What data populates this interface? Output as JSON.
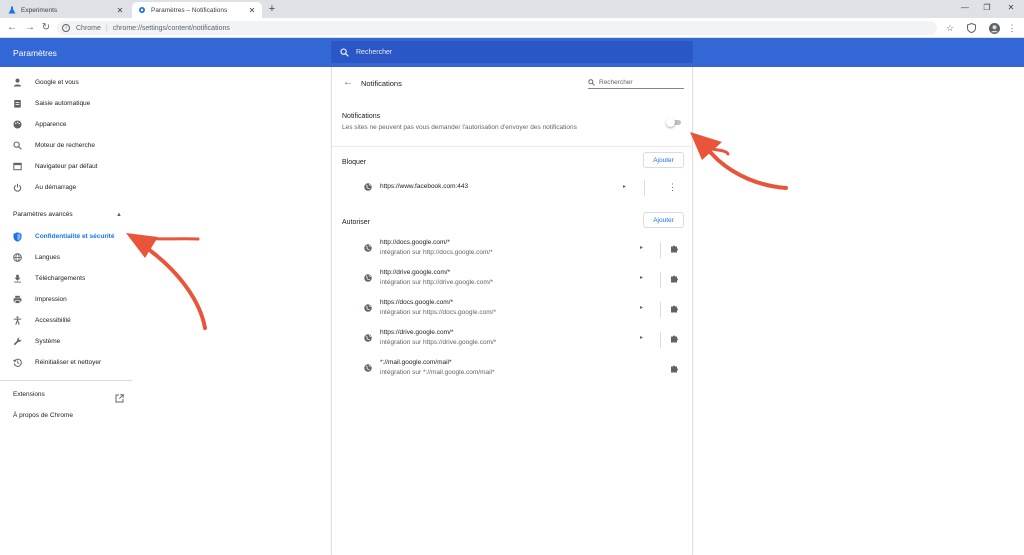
{
  "browser": {
    "tabs": [
      {
        "title": "Experiments",
        "icon": "flask-icon",
        "active": false
      },
      {
        "title": "Paramètres – Notifications",
        "icon": "gear-icon",
        "active": true
      }
    ],
    "close_glyph": "✕",
    "new_tab_glyph": "+",
    "window_controls": {
      "minimize": "—",
      "maximize": "❐",
      "close": "✕"
    },
    "nav": {
      "back": "←",
      "forward": "→",
      "reload": "↻"
    },
    "omnibox": {
      "scheme": "Chrome",
      "separator": "|",
      "url": "chrome://settings/content/notifications"
    },
    "toolbar_icons": {
      "star": "☆",
      "shield": "shield-icon",
      "avatar": "avatar-icon",
      "menu": "⋮"
    }
  },
  "header": {
    "title": "Paramètres",
    "search_placeholder": "Rechercher",
    "color": "#3367d6"
  },
  "sidebar": {
    "items": [
      {
        "label": "Google et vous",
        "icon": "person-icon"
      },
      {
        "label": "Saisie automatique",
        "icon": "clipboard-icon"
      },
      {
        "label": "Apparence",
        "icon": "palette-icon"
      },
      {
        "label": "Moteur de recherche",
        "icon": "search-icon"
      },
      {
        "label": "Navigateur par défaut",
        "icon": "browser-icon"
      },
      {
        "label": "Au démarrage",
        "icon": "power-icon"
      }
    ],
    "advanced_label": "Paramètres avancés",
    "advanced_caret": "▲",
    "advanced_items": [
      {
        "label": "Confidentialité et sécurité",
        "icon": "shield-icon",
        "active": true
      },
      {
        "label": "Langues",
        "icon": "globe-icon"
      },
      {
        "label": "Téléchargements",
        "icon": "download-icon"
      },
      {
        "label": "Impression",
        "icon": "printer-icon"
      },
      {
        "label": "Accessibilité",
        "icon": "accessibility-icon"
      },
      {
        "label": "Système",
        "icon": "wrench-icon"
      },
      {
        "label": "Réinitialiser et nettoyer",
        "icon": "history-icon"
      }
    ],
    "extensions_label": "Extensions",
    "about_label": "À propos de Chrome"
  },
  "main": {
    "back_glyph": "←",
    "page_title": "Notifications",
    "search_placeholder": "Rechercher",
    "notifications": {
      "title": "Notifications",
      "description": "Les sites ne peuvent pas vous demander l'autorisation d'envoyer des notifications",
      "enabled": false
    },
    "block": {
      "label": "Bloquer",
      "add_label": "Ajouter",
      "sites": [
        {
          "url": "https://www.facebook.com:443",
          "arrow": "▸",
          "more": "⋮"
        }
      ]
    },
    "allow": {
      "label": "Autoriser",
      "add_label": "Ajouter",
      "sites": [
        {
          "url": "http://docs.google.com/*",
          "sub": "intégration sur http://docs.google.com/*",
          "arrow": "▸"
        },
        {
          "url": "http://drive.google.com/*",
          "sub": "intégration sur http://drive.google.com/*",
          "arrow": "▸"
        },
        {
          "url": "https://docs.google.com/*",
          "sub": "intégration sur https://docs.google.com/*",
          "arrow": "▸"
        },
        {
          "url": "https://drive.google.com/*",
          "sub": "intégration sur https://drive.google.com/*",
          "arrow": "▸"
        },
        {
          "url": "*://mail.google.com/mail*",
          "sub": "intégration sur *://mail.google.com/mail*",
          "arrow": ""
        }
      ]
    }
  },
  "annotations": {
    "arrow_color": "#e8553a"
  }
}
